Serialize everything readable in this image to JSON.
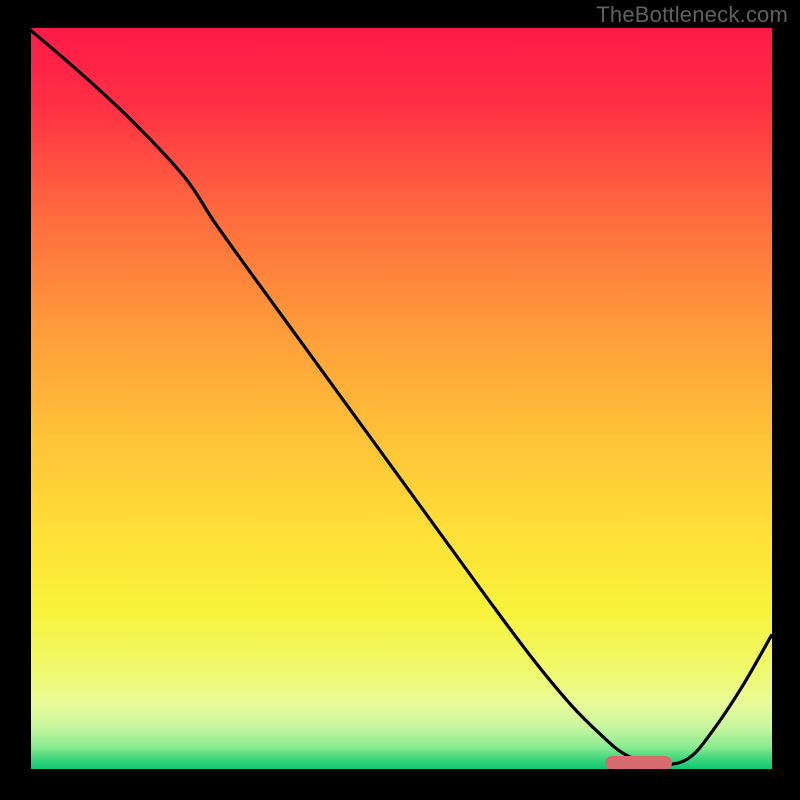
{
  "watermark": "TheBottleneck.com",
  "chart_data": {
    "type": "line",
    "title": "",
    "xlabel": "",
    "ylabel": "",
    "xlim": [
      0,
      100
    ],
    "ylim": [
      0,
      100
    ],
    "grid": false,
    "legend": false,
    "series": [
      {
        "name": "curve",
        "color": "#000000",
        "x": [
          0.0,
          7.0,
          14.0,
          21.0,
          25.0,
          30.0,
          38.0,
          46.0,
          54.0,
          62.0,
          68.0,
          73.0,
          77.0,
          80.0,
          83.0,
          86.0,
          89.0,
          92.0,
          96.0,
          100.0
        ],
        "y": [
          100.0,
          94.0,
          87.5,
          80.0,
          74.0,
          67.0,
          56.0,
          45.0,
          34.0,
          23.0,
          15.0,
          9.0,
          5.0,
          2.5,
          1.3,
          1.0,
          2.0,
          5.5,
          11.5,
          18.5
        ]
      }
    ],
    "marker": {
      "color": "#d86b70",
      "x_range": [
        77.5,
        86.5
      ],
      "y": 1.2,
      "shape": "pill"
    },
    "background_gradient": {
      "direction": "vertical",
      "stops": [
        {
          "y": 100,
          "color": "#ff1a48"
        },
        {
          "y": 90,
          "color": "#ff2e44"
        },
        {
          "y": 75,
          "color": "#ff6a3e"
        },
        {
          "y": 60,
          "color": "#ff9a3a"
        },
        {
          "y": 45,
          "color": "#ffc238"
        },
        {
          "y": 32,
          "color": "#ffe038"
        },
        {
          "y": 22,
          "color": "#f8f23a"
        },
        {
          "y": 14,
          "color": "#f0f96a"
        },
        {
          "y": 9,
          "color": "#e8fa9a"
        },
        {
          "y": 6,
          "color": "#c8f7a0"
        },
        {
          "y": 3.5,
          "color": "#8eec91"
        },
        {
          "y": 1.5,
          "color": "#34d37a"
        },
        {
          "y": 0,
          "color": "#00c46a"
        }
      ]
    }
  }
}
